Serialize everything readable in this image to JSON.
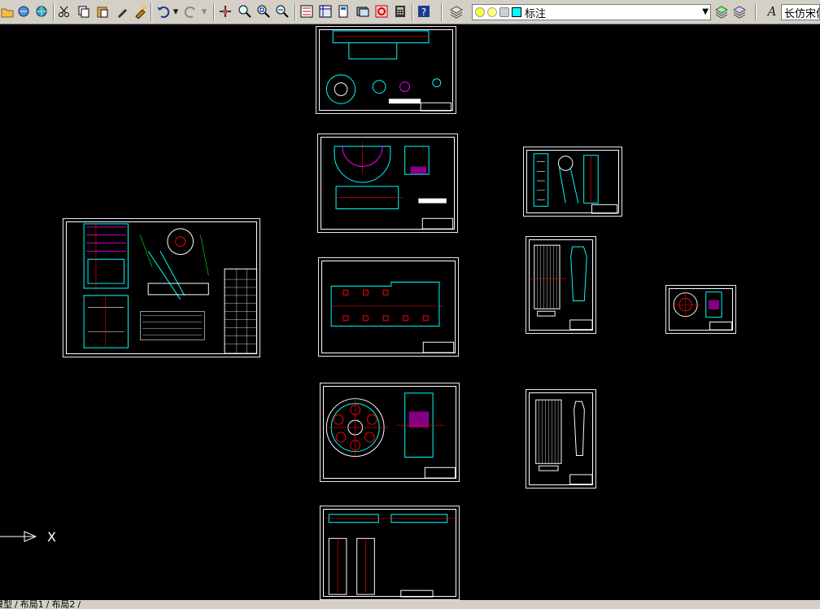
{
  "toolbar": {
    "layer_name": "标注",
    "text_style": "长仿宋体",
    "layer_bulb_color": "#ffff00",
    "layer_sun_color": "#ffff00",
    "layer_color_swatch": "#00ffff"
  },
  "layout_tabs": {
    "model": "模型",
    "layout1": "布局1",
    "layout2": "布局2"
  },
  "ucs": {
    "x_label": "X"
  },
  "colors": {
    "background": "#000000",
    "sheet_border": "#ffffff",
    "geometry_cyan": "#00ffff",
    "geometry_red": "#ff0000",
    "geometry_magenta": "#ff00ff",
    "geometry_green": "#00ff00",
    "geometry_yellow": "#ffff00",
    "geometry_blue": "#4040ff"
  }
}
